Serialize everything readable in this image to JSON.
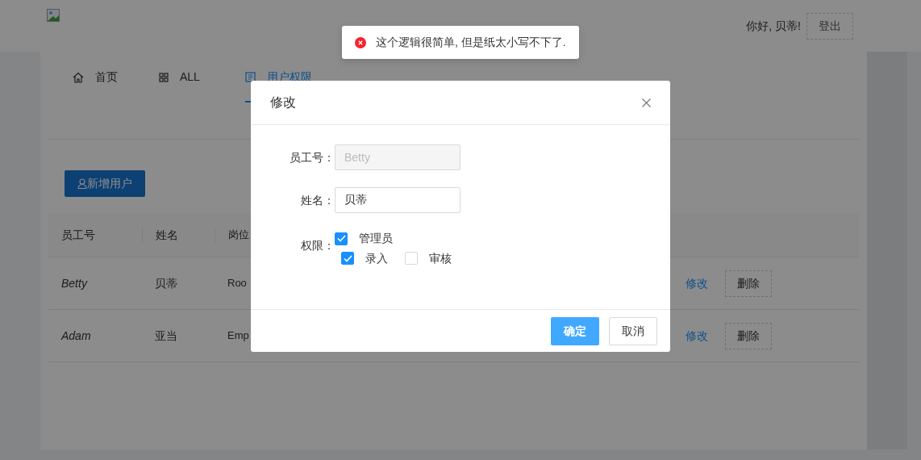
{
  "header": {
    "greeting": "你好, 贝蒂!",
    "logout": "登出"
  },
  "toast": {
    "kind": "error",
    "message": "这个逻辑很简单, 但是纸太小写不下了."
  },
  "tabs": [
    {
      "label": "首页",
      "kind": "home",
      "selected": false
    },
    {
      "label": "ALL",
      "kind": "grid",
      "selected": false
    },
    {
      "label": "用户权限",
      "kind": "doc",
      "selected": true
    }
  ],
  "add_button": "新增用户",
  "table": {
    "columns": [
      "员工号",
      "姓名",
      "岗位"
    ],
    "rows": [
      {
        "cells": [
          "Betty",
          "贝蒂",
          "Roo"
        ],
        "edit": "修改",
        "delete": "删除"
      },
      {
        "cells": [
          "Adam",
          "亚当",
          "Emp"
        ],
        "edit": "修改",
        "delete": "删除"
      }
    ]
  },
  "dialog": {
    "title": "修改",
    "fields": [
      {
        "label": "员工号：",
        "value": "Betty",
        "disabled": true
      },
      {
        "label": "姓名：",
        "value": "贝蒂",
        "disabled": false
      }
    ],
    "permissions": {
      "label": "权限：",
      "options": [
        {
          "label": "管理员",
          "checked": true,
          "children": [
            {
              "label": "录入",
              "checked": true
            },
            {
              "label": "审核",
              "checked": false
            }
          ]
        }
      ]
    },
    "buttons": [
      {
        "label": "确定",
        "kind": "primary"
      },
      {
        "label": "取消",
        "kind": "default"
      }
    ]
  }
}
